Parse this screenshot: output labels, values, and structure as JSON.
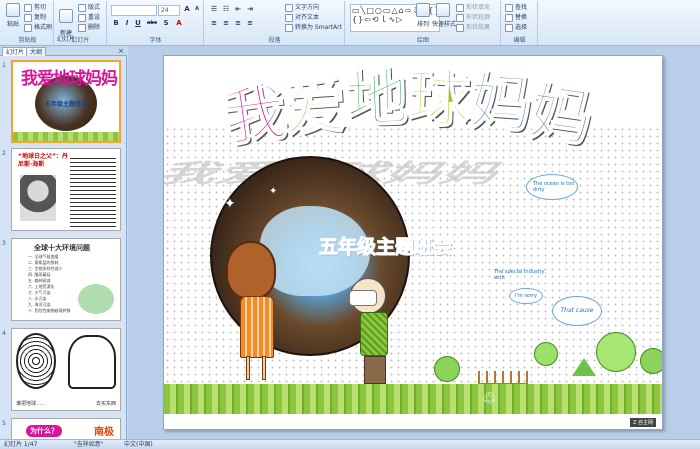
{
  "ribbon": {
    "clipboard": {
      "group": "剪贴板",
      "paste": "粘贴",
      "cut": "剪切",
      "copy": "复制",
      "format_painter": "格式刷"
    },
    "slides": {
      "group": "幻灯片",
      "new_slide": "新建\n幻灯片",
      "layout": "版式",
      "reset": "重设",
      "delete": "删除"
    },
    "font": {
      "group": "字体",
      "font_size": "24",
      "bold": "B",
      "italic": "I",
      "underline": "U",
      "strike": "abc",
      "shadow": "S"
    },
    "paragraph": {
      "group": "段落",
      "text_direction": "文字方向",
      "align_text": "对齐文本",
      "smartart": "转换为 SmartArt"
    },
    "drawing": {
      "group": "绘图",
      "shapes_glyphs": "▭╲□○▭△⌂⇨⇩☆{}{}⇦⟲ｌ∿▷",
      "arrange": "排列",
      "quick_styles": "快速样式",
      "shape_fill": "形状填充",
      "shape_outline": "形状轮廓",
      "shape_effects": "形状效果"
    },
    "editing": {
      "group": "编辑",
      "find": "查找",
      "replace": "替换",
      "select": "选择"
    }
  },
  "panel": {
    "tabs": [
      "幻灯片",
      "大纲"
    ],
    "slides": [
      {
        "num": "1",
        "title": "我爱地球妈妈",
        "subtitle": "五年级主题班会"
      },
      {
        "num": "2",
        "title": "“地球日之父”：丹尼斯·海斯"
      },
      {
        "num": "3",
        "title": "全球十大环境问题",
        "items": [
          "一. 全球气候变暖",
          "二. 臭氧层的损耗",
          "三. 生物多样性减少",
          "四. 酸雨蔓延",
          "五. 森林锐减",
          "六. 土地荒漠化",
          "七. 大气污染",
          "八. 水污染",
          "九. 海洋污染",
          "十. 危险性废物越境转移"
        ]
      },
      {
        "num": "4",
        "caption_left": "谁把地球……",
        "caption_right": "去买东西"
      },
      {
        "num": "5",
        "title": "为什么？",
        "side": "南极"
      }
    ]
  },
  "slide": {
    "title_chars": [
      "我",
      "爱",
      "地",
      "球",
      "妈",
      "妈"
    ],
    "subtitle": "五年级主题班会",
    "bubbles": [
      "The ocean is too dirty",
      "The special Industry, with",
      "That cause"
    ],
    "bubble_small": "I'm sorry",
    "brand": "Z 自主网"
  },
  "status": {
    "slide_info": "幻灯片 1/47",
    "theme": "\"吉祥如意\"",
    "lang": "中文(中国)"
  },
  "colors": {
    "title": [
      "#d9159a",
      "#f07a0c",
      "#1a9b2f",
      "#9dc321",
      "#2468c8",
      "#7a2aa8"
    ],
    "accent": "#f6a330"
  }
}
